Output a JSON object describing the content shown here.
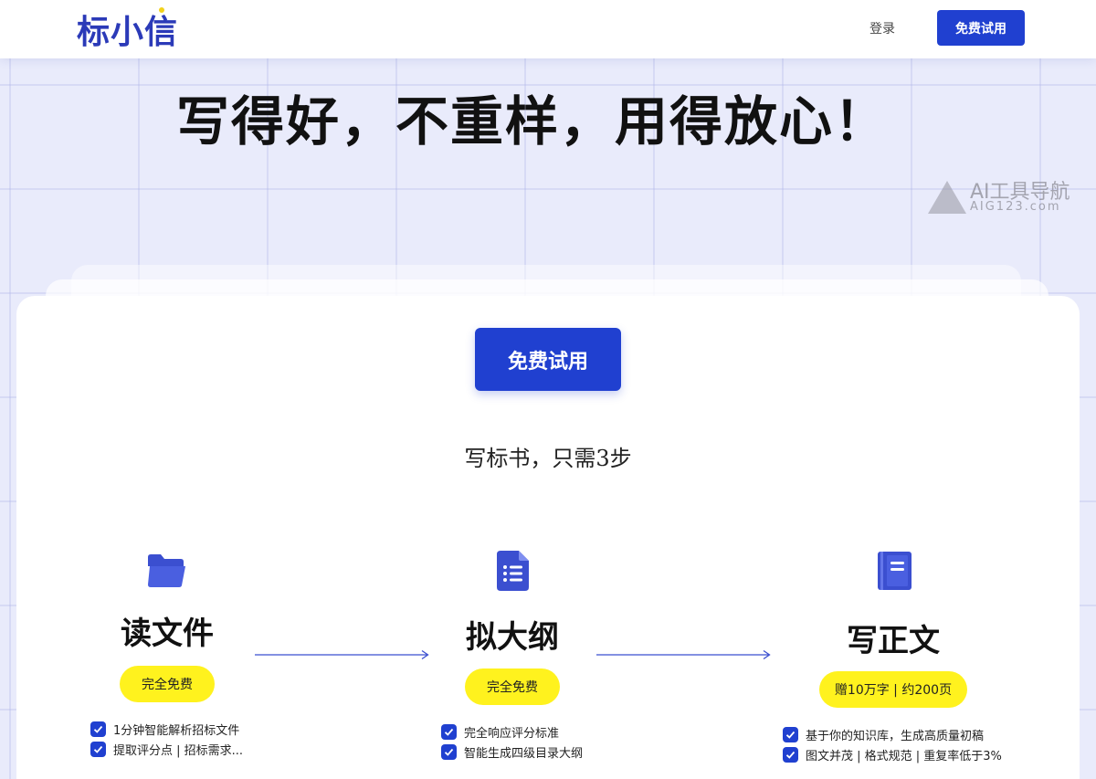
{
  "header": {
    "logo": "标小信",
    "login_label": "登录",
    "cta_label": "免费试用"
  },
  "hero": {
    "title": "写得好，不重样，用得放心！"
  },
  "watermark": {
    "line1": "AI工具导航",
    "line2": "AIG123.com"
  },
  "main": {
    "cta_label": "免费试用",
    "subtitle": "写标书，只需3步"
  },
  "steps": [
    {
      "title": "读文件",
      "badge": "完全免费",
      "icon": "folder-icon",
      "features": [
        "1分钟智能解析招标文件",
        "提取评分点 | 招标需求..."
      ]
    },
    {
      "title": "拟大纲",
      "badge": "完全免费",
      "icon": "document-list-icon",
      "features": [
        "完全响应评分标准",
        "智能生成四级目录大纲"
      ]
    },
    {
      "title": "写正文",
      "badge": "赠10万字 | 约200页",
      "icon": "book-icon",
      "features": [
        "基于你的知识库，生成高质量初稿",
        "图文并茂 | 格式规范 | 重复率低于3%"
      ]
    }
  ],
  "colors": {
    "brand_blue": "#2040d0",
    "badge_yellow": "#fff21e",
    "icon_blue": "#3b4fd0"
  }
}
